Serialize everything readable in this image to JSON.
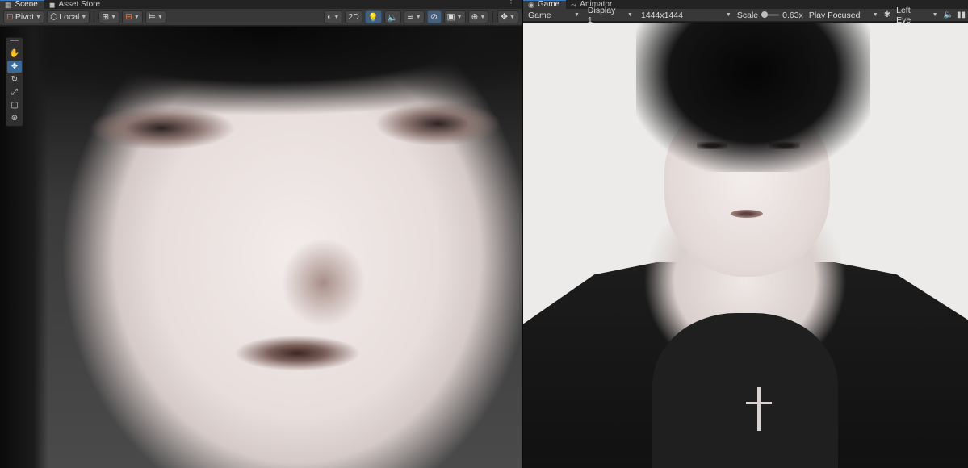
{
  "scene_tabs": {
    "scene": {
      "label": "Scene",
      "icon": "grid-icon"
    },
    "asset_store": {
      "label": "Asset Store",
      "icon": "bag-icon"
    },
    "menu_icon": "kebab-menu-icon"
  },
  "scene_toolbar": {
    "pivot_label": "Pivot",
    "local_label": "Local",
    "mode_2d_label": "2D"
  },
  "vertical_tools": [
    "hand-tool",
    "move-tool",
    "rotate-tool",
    "scale-tool",
    "rect-tool",
    "transform-tool"
  ],
  "game_tabs": {
    "game": {
      "label": "Game",
      "icon": "gamepad-icon"
    },
    "animator": {
      "label": "Animator",
      "icon": "animator-icon"
    }
  },
  "game_toolbar": {
    "view_select": "Game",
    "display_select": "Display 1",
    "resolution_select": "1444x1444",
    "scale_label": "Scale",
    "scale_value": "0.63x",
    "play_mode_select": "Play Focused",
    "eye_select": "Left Eye"
  },
  "colors": {
    "accent_blue": "#3a79bb",
    "toolbar_bg": "#383838",
    "tab_bg": "#232323"
  }
}
